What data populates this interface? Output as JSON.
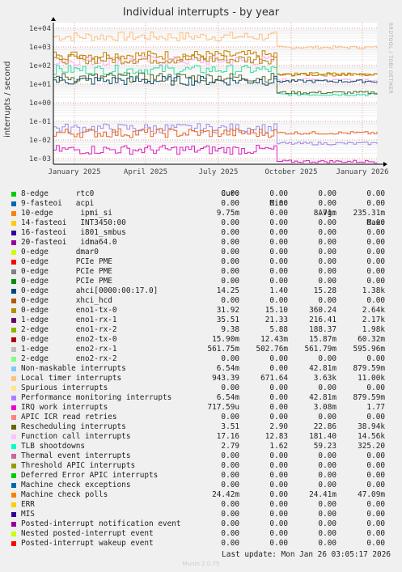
{
  "chart_data": {
    "type": "line",
    "title": "Individual interrupts - by year",
    "ylabel": "interrupts / second",
    "yscale": "log",
    "ylim": [
      0.0005,
      20000
    ],
    "y_ticks": [
      "1e+04",
      "1e+03",
      "1e+02",
      "1e+01",
      "1e+00",
      "1e-01",
      "1e-02",
      "1e-03"
    ],
    "x_ticks": [
      "January 2025",
      "April 2025",
      "July 2025",
      "October 2025",
      "January 2026"
    ],
    "grid": true,
    "series_highlights": [
      {
        "label": "Local timer interrupts",
        "color": "#ffbe7f",
        "before": 3600,
        "after": 943
      },
      {
        "label": "eno1-tx-0",
        "color": "#cc7e00",
        "before": 360,
        "after": 31.9
      },
      {
        "label": "Function call interrupts",
        "color": "#ffaaff",
        "before": 181,
        "after": 17.2
      },
      {
        "label": "eno1-rx-1",
        "color": "#b8860b",
        "before": 216,
        "after": 35.5
      },
      {
        "label": "TLB shootdowns",
        "color": "#30e0a0",
        "before": 59,
        "after": 2.8
      },
      {
        "label": "Rescheduling interrupts",
        "color": "#556b2f",
        "before": 22.9,
        "after": 3.5
      },
      {
        "label": "ahci[0000:00:17.0]",
        "color": "#0e4c64",
        "before": 15.3,
        "after": 14.25
      },
      {
        "label": "Performance monitoring interrupts",
        "color": "#9f8be8",
        "before": 0.043,
        "after": 0.0065
      },
      {
        "label": "Machine check polls",
        "color": "#e86424",
        "before": 0.024,
        "after": 0.024
      },
      {
        "label": "IRQ work interrupts",
        "color": "#e020c0",
        "before": 0.003,
        "after": 0.0007
      }
    ]
  },
  "legend": {
    "headers": {
      "cur": "Cur:",
      "min": "Min:",
      "avg": "Avg:",
      "max": "Max:"
    },
    "rows": [
      {
        "label": "8-edge      rtc0",
        "color": "#00cc00",
        "cur": "0.00",
        "min": "0.00",
        "avg": "0.00",
        "max": "0.00"
      },
      {
        "label": "9-fasteoi   acpi",
        "color": "#0066b3",
        "cur": "0.00",
        "min": "0.00",
        "avg": "0.00",
        "max": "0.00"
      },
      {
        "label": "10-edge      ipmi_si",
        "color": "#ff8000",
        "cur": "9.75m",
        "min": "0.00",
        "avg": "8.71m",
        "max": "235.31m"
      },
      {
        "label": "14-fasteoi   INT3450:00",
        "color": "#ffcc00",
        "cur": "0.00",
        "min": "0.00",
        "avg": "0.00",
        "max": "0.00"
      },
      {
        "label": "16-fasteoi   i801_smbus",
        "color": "#330099",
        "cur": "0.00",
        "min": "0.00",
        "avg": "0.00",
        "max": "0.00"
      },
      {
        "label": "20-fasteoi   idma64.0",
        "color": "#990099",
        "cur": "0.00",
        "min": "0.00",
        "avg": "0.00",
        "max": "0.00"
      },
      {
        "label": "0-edge      dmar0",
        "color": "#ccff00",
        "cur": "0.00",
        "min": "0.00",
        "avg": "0.00",
        "max": "0.00"
      },
      {
        "label": "0-edge      PCIe PME",
        "color": "#ff0000",
        "cur": "0.00",
        "min": "0.00",
        "avg": "0.00",
        "max": "0.00"
      },
      {
        "label": "0-edge      PCIe PME",
        "color": "#808080",
        "cur": "0.00",
        "min": "0.00",
        "avg": "0.00",
        "max": "0.00"
      },
      {
        "label": "0-edge      PCIe PME",
        "color": "#008f00",
        "cur": "0.00",
        "min": "0.00",
        "avg": "0.00",
        "max": "0.00"
      },
      {
        "label": "0-edge      ahci[0000:00:17.0]",
        "color": "#00487d",
        "cur": "14.25",
        "min": "1.40",
        "avg": "15.28",
        "max": "1.38k"
      },
      {
        "label": "0-edge      xhci_hcd",
        "color": "#b35a00",
        "cur": "0.00",
        "min": "0.00",
        "avg": "0.00",
        "max": "0.00"
      },
      {
        "label": "0-edge      eno1-tx-0",
        "color": "#b38f00",
        "cur": "31.92",
        "min": "15.10",
        "avg": "360.24",
        "max": "2.64k"
      },
      {
        "label": "1-edge      eno1-rx-1",
        "color": "#6b006b",
        "cur": "35.51",
        "min": "21.33",
        "avg": "216.41",
        "max": "2.17k"
      },
      {
        "label": "2-edge      eno1-rx-2",
        "color": "#8fb300",
        "cur": "9.38",
        "min": "5.88",
        "avg": "188.37",
        "max": "1.98k"
      },
      {
        "label": "0-edge      eno2-tx-0",
        "color": "#b30000",
        "cur": "15.90m",
        "min": "12.43m",
        "avg": "15.87m",
        "max": "60.32m"
      },
      {
        "label": "1-edge      eno2-rx-1",
        "color": "#bebebe",
        "cur": "561.75m",
        "min": "502.76m",
        "avg": "561.79m",
        "max": "595.96m"
      },
      {
        "label": "2-edge      eno2-rx-2",
        "color": "#80ff80",
        "cur": "0.00",
        "min": "0.00",
        "avg": "0.00",
        "max": "0.00"
      },
      {
        "label": "Non-maskable interrupts",
        "color": "#80c9ff",
        "cur": "6.54m",
        "min": "0.00",
        "avg": "42.81m",
        "max": "879.59m"
      },
      {
        "label": "Local timer interrupts",
        "color": "#ffc080",
        "cur": "943.39",
        "min": "671.64",
        "avg": "3.63k",
        "max": "11.00k"
      },
      {
        "label": "Spurious interrupts",
        "color": "#ffe680",
        "cur": "0.00",
        "min": "0.00",
        "avg": "0.00",
        "max": "0.00"
      },
      {
        "label": "Performance monitoring interrupts",
        "color": "#aa80ff",
        "cur": "6.54m",
        "min": "0.00",
        "avg": "42.81m",
        "max": "879.59m"
      },
      {
        "label": "IRQ work interrupts",
        "color": "#ee00cc",
        "cur": "717.59u",
        "min": "0.00",
        "avg": "3.08m",
        "max": "1.77"
      },
      {
        "label": "APIC ICR read retries",
        "color": "#ff8080",
        "cur": "0.00",
        "min": "0.00",
        "avg": "0.00",
        "max": "0.00"
      },
      {
        "label": "Rescheduling interrupts",
        "color": "#666600",
        "cur": "3.51",
        "min": "2.90",
        "avg": "22.86",
        "max": "38.94k"
      },
      {
        "label": "Function call interrupts",
        "color": "#ffbfff",
        "cur": "17.16",
        "min": "12.83",
        "avg": "181.40",
        "max": "14.56k"
      },
      {
        "label": "TLB shootdowns",
        "color": "#00ffcc",
        "cur": "2.79",
        "min": "1.62",
        "avg": "59.23",
        "max": "325.20"
      },
      {
        "label": "Thermal event interrupts",
        "color": "#cc6699",
        "cur": "0.00",
        "min": "0.00",
        "avg": "0.00",
        "max": "0.00"
      },
      {
        "label": "Threshold APIC interrupts",
        "color": "#999900",
        "cur": "0.00",
        "min": "0.00",
        "avg": "0.00",
        "max": "0.00"
      },
      {
        "label": "Deferred Error APIC interrupts",
        "color": "#00cc00",
        "cur": "0.00",
        "min": "0.00",
        "avg": "0.00",
        "max": "0.00"
      },
      {
        "label": "Machine check exceptions",
        "color": "#0066b3",
        "cur": "0.00",
        "min": "0.00",
        "avg": "0.00",
        "max": "0.00"
      },
      {
        "label": "Machine check polls",
        "color": "#ff8000",
        "cur": "24.42m",
        "min": "0.00",
        "avg": "24.41m",
        "max": "47.09m"
      },
      {
        "label": "ERR",
        "color": "#ffcc00",
        "cur": "0.00",
        "min": "0.00",
        "avg": "0.00",
        "max": "0.00"
      },
      {
        "label": "MIS",
        "color": "#330099",
        "cur": "0.00",
        "min": "0.00",
        "avg": "0.00",
        "max": "0.00"
      },
      {
        "label": "Posted-interrupt notification event",
        "color": "#990099",
        "cur": "0.00",
        "min": "0.00",
        "avg": "0.00",
        "max": "0.00"
      },
      {
        "label": "Nested posted-interrupt event",
        "color": "#ccff00",
        "cur": "0.00",
        "min": "0.00",
        "avg": "0.00",
        "max": "0.00"
      },
      {
        "label": "Posted-interrupt wakeup event",
        "color": "#ff0000",
        "cur": "0.00",
        "min": "0.00",
        "avg": "0.00",
        "max": "0.00"
      }
    ]
  },
  "footer": "Last update: Mon Jan 26 03:05:17 2026",
  "watermark": "RRDTOOL / TOBI OETIKER",
  "munin_version": "Munin 2.0.75"
}
